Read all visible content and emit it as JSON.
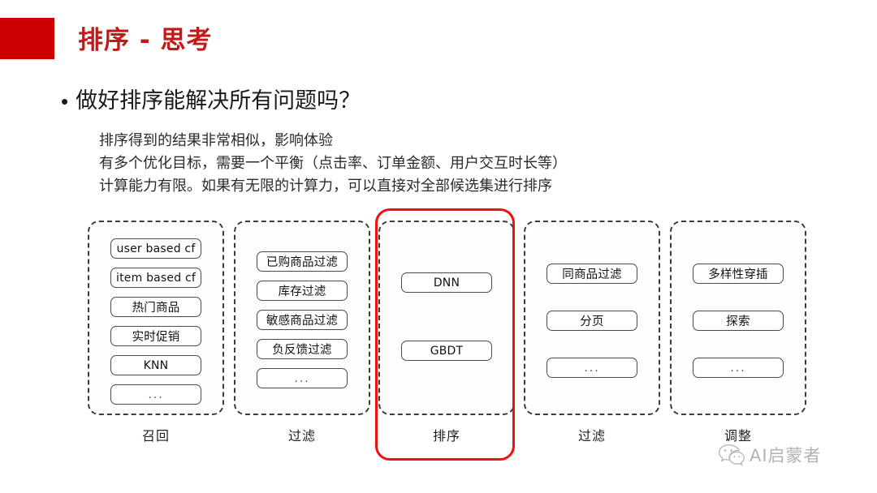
{
  "slide": {
    "title": "排序 - 思考",
    "accent_color": "#CC0000",
    "title_color": "#C21A1A",
    "bullet": {
      "marker": "•",
      "text": "做好排序能解决所有问题吗？"
    },
    "paragraph": "排序得到的结果非常相似，影响体验\n有多个优化目标，需要一个平衡（点击率、订单金额、用户交互时长等）\n计算能力有限。如果有无限的计算力，可以直接对全部候选集进行排序"
  },
  "pipeline": {
    "highlight_color": "#EE1111",
    "highlighted_stage_index": 2,
    "stages": [
      {
        "label": "召回",
        "highlighted": false,
        "items": [
          "user based cf",
          "item based cf",
          "热门商品",
          "实时促销",
          "KNN",
          "..."
        ]
      },
      {
        "label": "过滤",
        "highlighted": false,
        "items": [
          "已购商品过滤",
          "库存过滤",
          "敏感商品过滤",
          "负反馈过滤",
          "..."
        ]
      },
      {
        "label": "排序",
        "highlighted": true,
        "items": [
          "DNN",
          "GBDT"
        ]
      },
      {
        "label": "过滤",
        "highlighted": false,
        "items": [
          "同商品过滤",
          "分页",
          "..."
        ]
      },
      {
        "label": "调整",
        "highlighted": false,
        "items": [
          "多样性穿插",
          "探索",
          "..."
        ]
      }
    ]
  },
  "watermark": {
    "icon": "wechat-icon",
    "text": "AI启蒙者"
  }
}
